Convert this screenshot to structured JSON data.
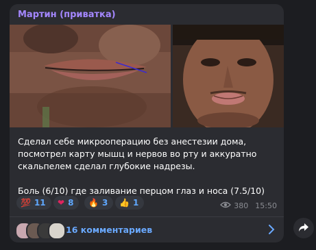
{
  "message": {
    "author": "Мартин (приватка)",
    "text_line1": "Сделал себе микрооперацию без анестезии дома, посмотрел карту мышц и нервов во рту и аккуратно скальпелем сделал глубокие надрезы.",
    "text_line2": "Боль (6/10) где заливание перцом глаз и носа (7.5/10)",
    "views": "380",
    "time": "15:50"
  },
  "reactions": [
    {
      "emoji": "💯",
      "count": "11"
    },
    {
      "emoji": "❤",
      "count": "8"
    },
    {
      "emoji": "🔥",
      "count": "3"
    },
    {
      "emoji": "👍",
      "count": "1"
    }
  ],
  "comments": {
    "label": "16 комментариев"
  },
  "colors": {
    "author": "#a487ff",
    "link": "#6aa9ff",
    "bubble": "#2b2c31",
    "background": "#1c1d21"
  },
  "icons": [
    "eye-icon",
    "chevron-right-icon",
    "share-arrow-icon"
  ]
}
